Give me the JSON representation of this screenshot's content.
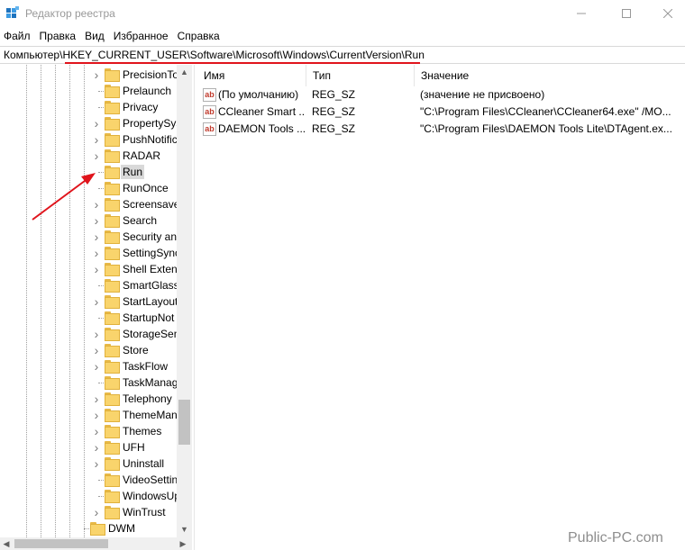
{
  "window": {
    "title": "Редактор реестра",
    "icon": "regedit-icon"
  },
  "menu": [
    "Файл",
    "Правка",
    "Вид",
    "Избранное",
    "Справка"
  ],
  "address": {
    "path": "Компьютер\\HKEY_CURRENT_USER\\Software\\Microsoft\\Windows\\CurrentVersion\\Run",
    "highlight_color": "#e0141c"
  },
  "tree": {
    "items": [
      {
        "label": "PrecisionTo",
        "expandable": true,
        "selected": false
      },
      {
        "label": "Prelaunch",
        "expandable": false,
        "selected": false
      },
      {
        "label": "Privacy",
        "expandable": false,
        "selected": false
      },
      {
        "label": "PropertySys",
        "expandable": true,
        "selected": false
      },
      {
        "label": "PushNotific",
        "expandable": true,
        "selected": false
      },
      {
        "label": "RADAR",
        "expandable": true,
        "selected": false
      },
      {
        "label": "Run",
        "expandable": false,
        "selected": true
      },
      {
        "label": "RunOnce",
        "expandable": false,
        "selected": false
      },
      {
        "label": "Screensave",
        "expandable": true,
        "selected": false
      },
      {
        "label": "Search",
        "expandable": true,
        "selected": false
      },
      {
        "label": "Security an",
        "expandable": true,
        "selected": false
      },
      {
        "label": "SettingSync",
        "expandable": true,
        "selected": false
      },
      {
        "label": "Shell Extens",
        "expandable": true,
        "selected": false
      },
      {
        "label": "SmartGlass",
        "expandable": false,
        "selected": false
      },
      {
        "label": "StartLayout",
        "expandable": true,
        "selected": false
      },
      {
        "label": "StartupNot",
        "expandable": false,
        "selected": false
      },
      {
        "label": "StorageSen",
        "expandable": true,
        "selected": false
      },
      {
        "label": "Store",
        "expandable": true,
        "selected": false
      },
      {
        "label": "TaskFlow",
        "expandable": true,
        "selected": false
      },
      {
        "label": "TaskManag",
        "expandable": false,
        "selected": false
      },
      {
        "label": "Telephony",
        "expandable": true,
        "selected": false
      },
      {
        "label": "ThemeMan",
        "expandable": true,
        "selected": false
      },
      {
        "label": "Themes",
        "expandable": true,
        "selected": false
      },
      {
        "label": "UFH",
        "expandable": true,
        "selected": false
      },
      {
        "label": "Uninstall",
        "expandable": true,
        "selected": false
      },
      {
        "label": "VideoSettin",
        "expandable": false,
        "selected": false
      },
      {
        "label": "WindowsUp",
        "expandable": false,
        "selected": false
      },
      {
        "label": "WinTrust",
        "expandable": true,
        "selected": false
      }
    ],
    "parent_item": {
      "label": "DWM",
      "expandable": false
    }
  },
  "values_table": {
    "columns": [
      "Имя",
      "Тип",
      "Значение"
    ],
    "rows": [
      {
        "name": "(По умолчанию)",
        "type": "REG_SZ",
        "data": "(значение не присвоено)",
        "icon": "reg-string-icon"
      },
      {
        "name": "CCleaner Smart ...",
        "type": "REG_SZ",
        "data": "\"C:\\Program Files\\CCleaner\\CCleaner64.exe\" /MO...",
        "icon": "reg-string-icon"
      },
      {
        "name": "DAEMON Tools ...",
        "type": "REG_SZ",
        "data": "\"C:\\Program Files\\DAEMON Tools Lite\\DTAgent.ex...",
        "icon": "reg-string-icon"
      }
    ]
  },
  "annotation": {
    "arrow_color": "#e0141c"
  },
  "watermark": "Public-PC.com"
}
